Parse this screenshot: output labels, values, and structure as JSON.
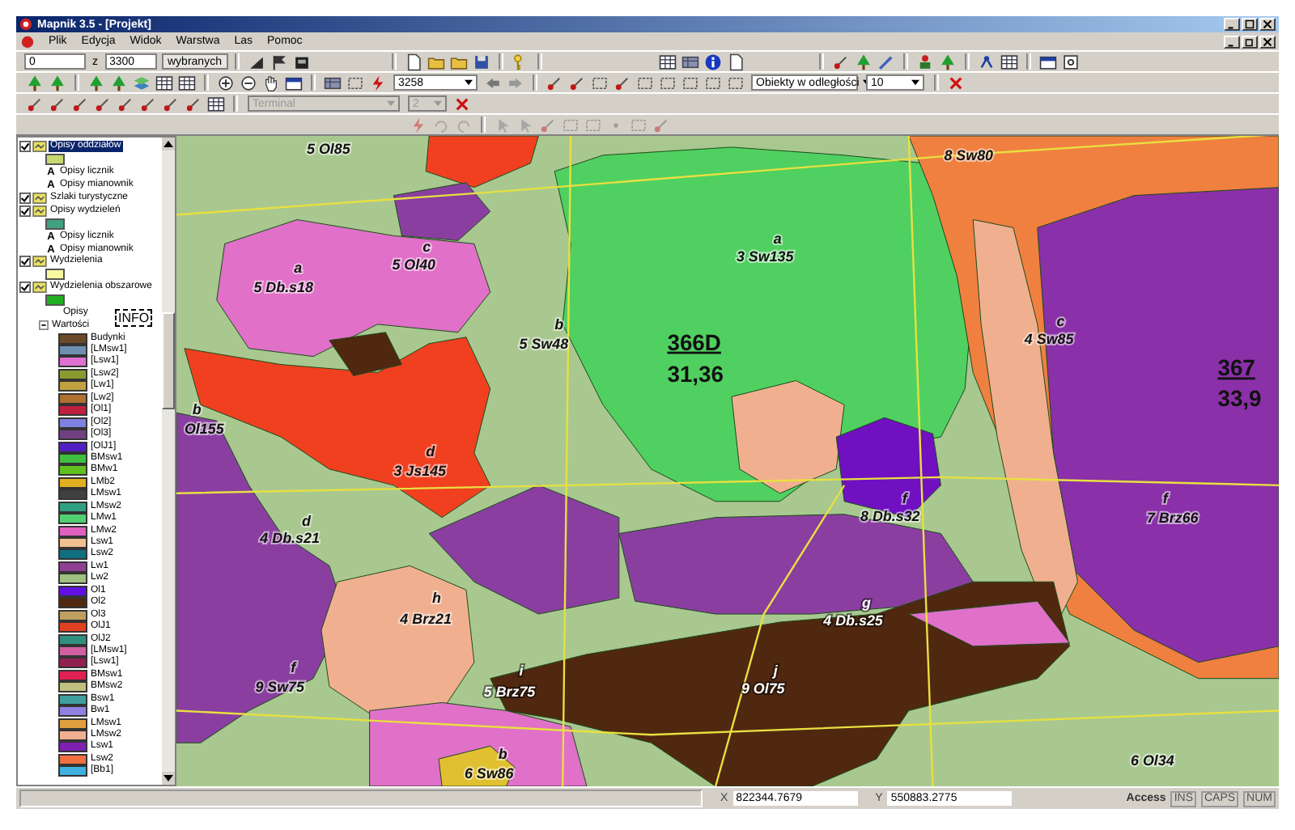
{
  "window": {
    "title": "Mapnik 3.5 - [Projekt]"
  },
  "menu": [
    "Plik",
    "Edycja",
    "Widok",
    "Warstwa",
    "Las",
    "Pomoc"
  ],
  "toolbar": {
    "from_field": "0",
    "to_label": "z",
    "to_field": "3300",
    "selection_button": "wybranych",
    "scale_combo": "3258",
    "distance_combo": "Obiekty w odległości",
    "distance_value": "10",
    "terminal_combo": {
      "value": "Terminal",
      "disabled": true
    },
    "number_combo": {
      "value": "2",
      "disabled": true
    }
  },
  "layer_tree": {
    "info_label": "INFO",
    "items": [
      {
        "label": "Opisy oddziałów",
        "checked": true,
        "selected": true,
        "children": [
          {
            "kind": "swatch",
            "color": "#c8d870"
          },
          {
            "kind": "text",
            "icon": "A",
            "label": "Opisy licznik"
          },
          {
            "kind": "text",
            "icon": "A",
            "label": "Opisy mianownik"
          }
        ]
      },
      {
        "label": "Szlaki turystyczne",
        "checked": true,
        "selected": false
      },
      {
        "label": "Opisy wydzieleń",
        "checked": true,
        "selected": false,
        "children": [
          {
            "kind": "swatch",
            "color": "#40a080"
          },
          {
            "kind": "text",
            "icon": "A",
            "label": "Opisy licznik"
          },
          {
            "kind": "text",
            "icon": "A",
            "label": "Opisy mianownik"
          }
        ]
      },
      {
        "label": "Wydzielenia",
        "checked": true,
        "selected": false,
        "children": [
          {
            "kind": "swatch",
            "color": "#f8f8a0"
          }
        ]
      },
      {
        "label": "Wydzielenia obszarowe",
        "checked": true,
        "selected": false,
        "children": [
          {
            "kind": "swatch",
            "color": "#20b020"
          },
          {
            "kind": "plain",
            "label": "Opisy"
          },
          {
            "kind": "group",
            "label": "Wartości",
            "expanded": true,
            "children": [
              {
                "label": "Budynki",
                "color": "#6b4a2a"
              },
              {
                "label": "[LMsw1]",
                "color": "#6f8fb0"
              },
              {
                "label": "[Lsw1]",
                "color": "#e070d0"
              },
              {
                "label": "[Lsw2]",
                "color": "#8a9a30"
              },
              {
                "label": "[Lw1]",
                "color": "#c0a040"
              },
              {
                "label": "[Lw2]",
                "color": "#b07030"
              },
              {
                "label": "[Ol1]",
                "color": "#c02040"
              },
              {
                "label": "[Ol2]",
                "color": "#8080e0"
              },
              {
                "label": "[Ol3]",
                "color": "#704080"
              },
              {
                "label": "[OlJ1]",
                "color": "#5020c0"
              },
              {
                "label": "BMsw1",
                "color": "#40c040"
              },
              {
                "label": "BMw1",
                "color": "#60c020"
              },
              {
                "label": "LMb2",
                "color": "#e0b020"
              },
              {
                "label": "LMsw1",
                "color": "#404040"
              },
              {
                "label": "LMsw2",
                "color": "#30a080"
              },
              {
                "label": "LMw1",
                "color": "#50d070"
              },
              {
                "label": "LMw2",
                "color": "#e060c0"
              },
              {
                "label": "Lsw1",
                "color": "#f0c090"
              },
              {
                "label": "Lsw2",
                "color": "#107080"
              },
              {
                "label": "Lw1",
                "color": "#904090"
              },
              {
                "label": "Lw2",
                "color": "#a0c080"
              },
              {
                "label": "Ol1",
                "color": "#6010e0"
              },
              {
                "label": "Ol2",
                "color": "#502810"
              },
              {
                "label": "Ol3",
                "color": "#c0a060"
              },
              {
                "label": "OlJ1",
                "color": "#e04020"
              },
              {
                "label": "OlJ2",
                "color": "#309080"
              },
              {
                "label": "[LMsw1]",
                "color": "#d060a0"
              },
              {
                "label": "[Lsw1]",
                "color": "#902050"
              },
              {
                "label": "BMsw1",
                "color": "#e02050"
              },
              {
                "label": "BMsw2",
                "color": "#c0c080"
              },
              {
                "label": "Bsw1",
                "color": "#40a0a0"
              },
              {
                "label": "Bw1",
                "color": "#9080e0"
              },
              {
                "label": "LMsw1",
                "color": "#e0a040"
              },
              {
                "label": "LMsw2",
                "color": "#f0b090"
              },
              {
                "label": "Lsw1",
                "color": "#8020b0"
              },
              {
                "label": "Lsw2",
                "color": "#f07040"
              },
              {
                "label": "[Bb1]",
                "color": "#40b0e0"
              }
            ]
          }
        ]
      }
    ]
  },
  "map": {
    "labels": [
      {
        "code": "5 Ol85"
      },
      {
        "code": "8 Sw80"
      },
      {
        "letter": "a",
        "code": "3 Sw135"
      },
      {
        "letter": "c",
        "code": "5 Ol40"
      },
      {
        "letter": "a",
        "code": "5 Db.s18"
      },
      {
        "letter": "b",
        "code": "5 Sw48"
      },
      {
        "letter": "c",
        "code": "4 Sw85"
      },
      {
        "letter": "b",
        "code": "Ol155"
      },
      {
        "letter": "d",
        "code": "3 Js145"
      },
      {
        "letter": "f",
        "code": "8 Db.s32"
      },
      {
        "letter": "f",
        "code": "7 Brz66"
      },
      {
        "letter": "d",
        "code": "4 Db.s21"
      },
      {
        "letter": "h",
        "code": "4 Brz21"
      },
      {
        "letter": "g",
        "code": "4 Db.s25"
      },
      {
        "letter": "f",
        "code": "9 Sw75"
      },
      {
        "letter": "i",
        "code": "5 Brz75"
      },
      {
        "letter": "j",
        "code": "9 Ol75"
      },
      {
        "letter": "b",
        "code": "6 Sw86"
      },
      {
        "code": "6 Ol34"
      }
    ],
    "sections": [
      {
        "number": "366D",
        "area": "31,36"
      },
      {
        "number": "367",
        "area": "33,9"
      }
    ]
  },
  "status_bar": {
    "x_label": "X",
    "x_value": "822344.7679",
    "y_label": "Y",
    "y_value": "550883.2775",
    "mode": "Access",
    "indicators": [
      {
        "label": "INS",
        "active": false
      },
      {
        "label": "CAPS",
        "active": false
      },
      {
        "label": "NUM",
        "active": false
      }
    ]
  }
}
